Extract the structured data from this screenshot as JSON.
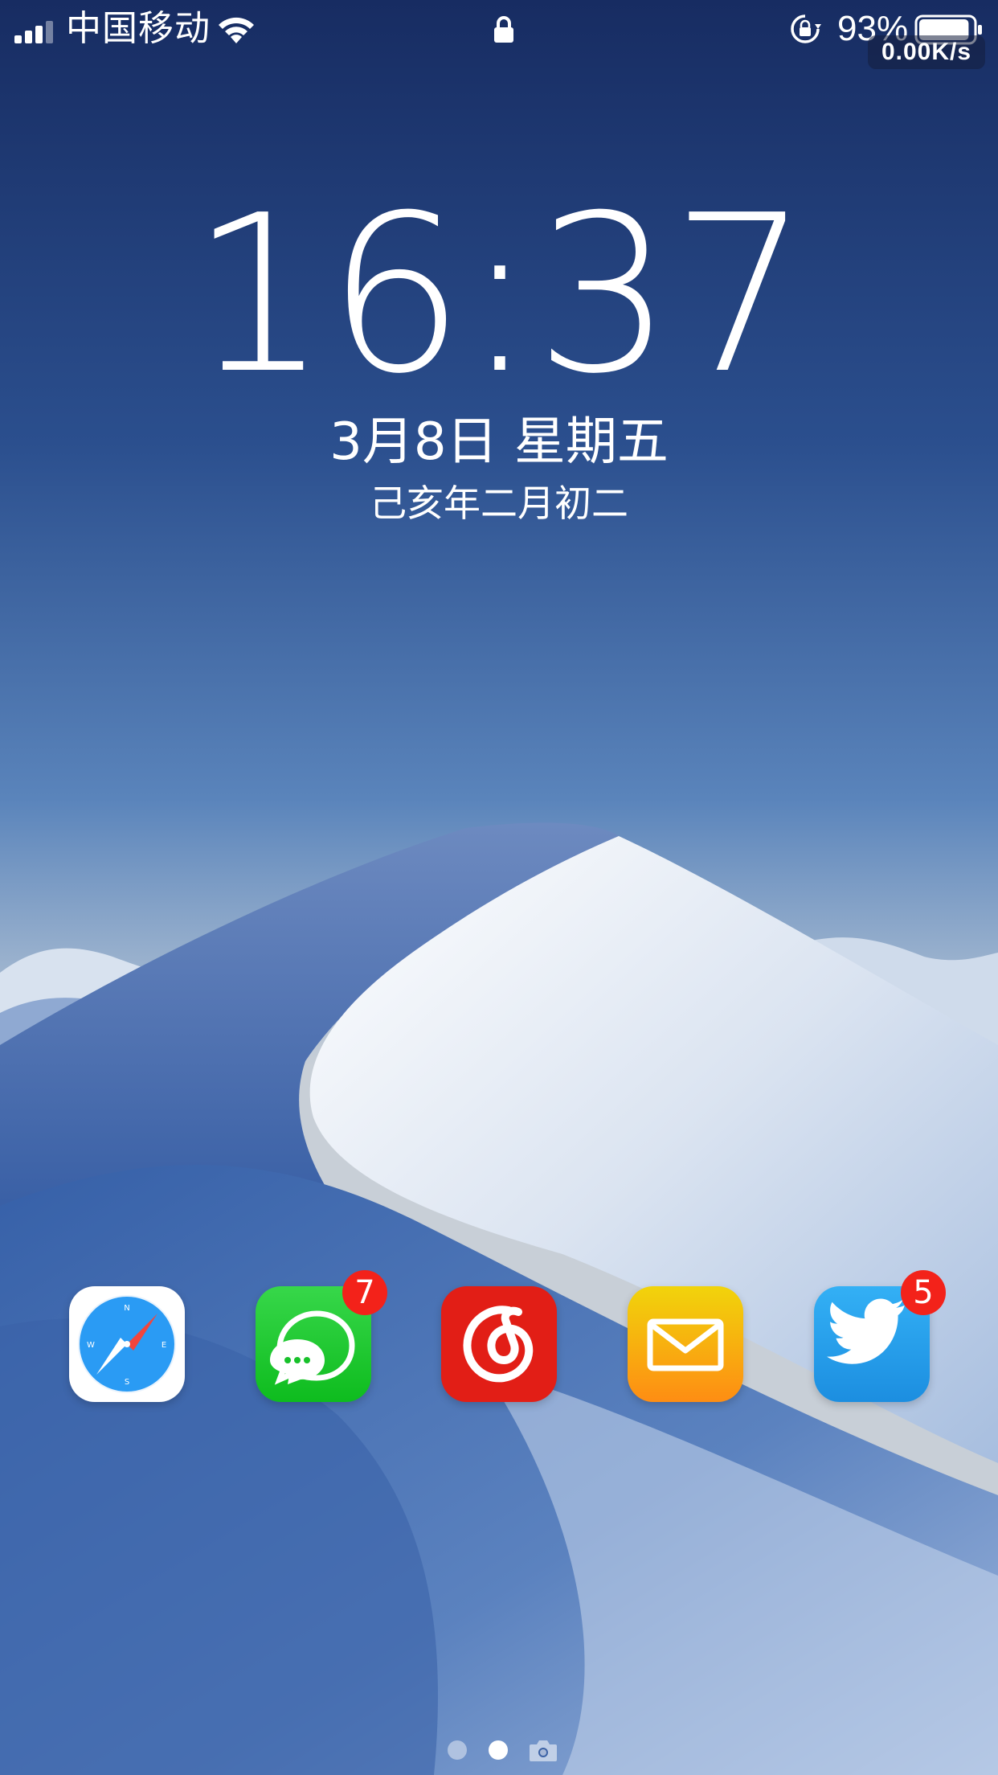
{
  "status_bar": {
    "carrier": "中国移动",
    "battery_percent": "93%",
    "battery_level": 0.93,
    "net_speed": "0.00K/s",
    "signal_bars": 3,
    "icons": [
      "signal-icon",
      "wifi-icon",
      "lock-icon",
      "rotation-lock-icon",
      "battery-icon"
    ]
  },
  "lock_screen": {
    "time": "16:37",
    "date": "3月8日 星期五",
    "lunar_date": "己亥年二月初二"
  },
  "dock": {
    "apps": [
      {
        "icon": "safari-compass-icon",
        "color": "#ffffff",
        "badge": null
      },
      {
        "icon": "messages-chat-icon",
        "color": "#17c12a",
        "badge": "7"
      },
      {
        "icon": "netease-music-icon",
        "color": "#e21e16",
        "badge": null
      },
      {
        "icon": "mail-envelope-icon",
        "color": "#fba613",
        "badge": null
      },
      {
        "icon": "twitter-bird-icon",
        "color": "#1fa0ef",
        "badge": "5"
      }
    ]
  },
  "page_indicator": {
    "pages": 2,
    "current": 2,
    "extra": "camera-icon"
  },
  "colors": {
    "sky_top": "#1b3066",
    "sky_mid": "#4e7ab4",
    "dune_light": "#dfe7f3",
    "dune_shadow": "#3e63a6",
    "badge_red": "#f3221a"
  }
}
